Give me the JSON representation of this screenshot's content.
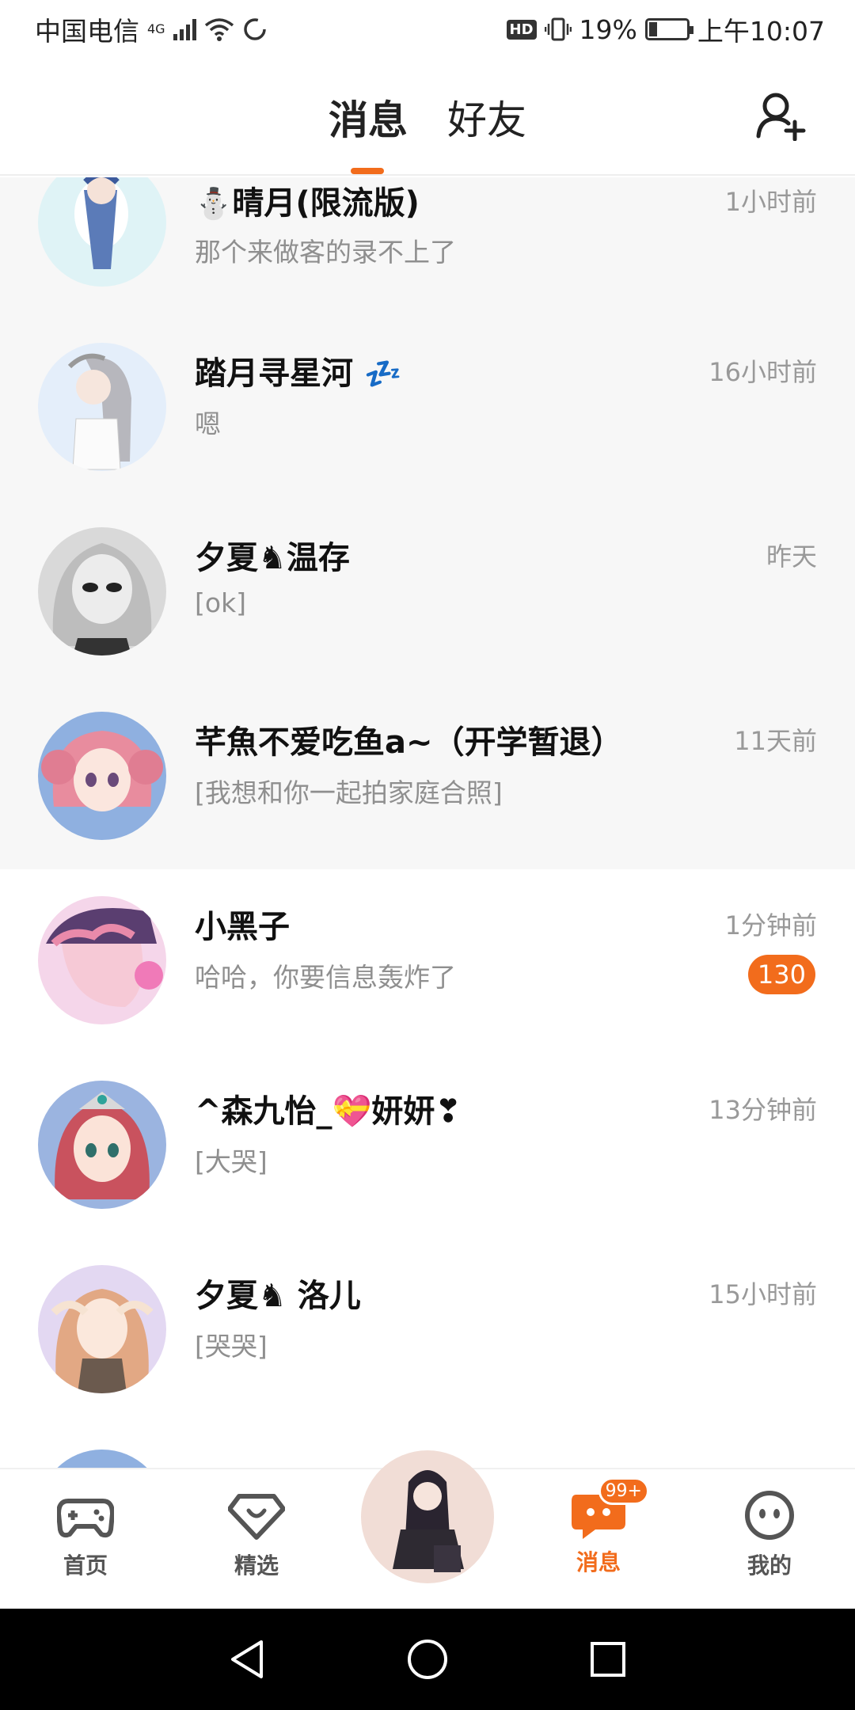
{
  "status_bar": {
    "carrier": "中国电信",
    "network": "4G",
    "battery_percent": "19%",
    "time": "上午10:07",
    "hd": "HD"
  },
  "header": {
    "tabs": [
      {
        "label": "消息",
        "active": true
      },
      {
        "label": "好友",
        "active": false
      }
    ],
    "add_friend_icon": "add-person-icon"
  },
  "conversations": [
    {
      "name": "晴月(限流版)",
      "prefix_emoji": "⛄",
      "suffix_emoji": "",
      "preview": "那个来做客的录不上了",
      "time": "1小时前",
      "pinned": true,
      "badge": ""
    },
    {
      "name": "踏月寻星河",
      "prefix_emoji": "",
      "suffix_emoji": "💤",
      "preview": "嗯",
      "time": "16小时前",
      "pinned": true,
      "badge": ""
    },
    {
      "name": "夕夏♞温存",
      "prefix_emoji": "",
      "suffix_emoji": "",
      "preview": "[ok]",
      "time": "昨天",
      "pinned": true,
      "badge": ""
    },
    {
      "name": "芊魚不爱吃鱼a~（开学暂退）",
      "prefix_emoji": "",
      "suffix_emoji": "",
      "preview": "[我想和你一起拍家庭合照]",
      "time": "11天前",
      "pinned": true,
      "badge": ""
    },
    {
      "name": "小黑子",
      "prefix_emoji": "",
      "suffix_emoji": "",
      "preview": "哈哈，你要信息轰炸了",
      "time": "1分钟前",
      "pinned": false,
      "badge": "130"
    },
    {
      "name": "^森九怡_💝妍妍❣",
      "prefix_emoji": "",
      "suffix_emoji": "",
      "preview": "[大哭]",
      "time": "13分钟前",
      "pinned": false,
      "badge": ""
    },
    {
      "name": "夕夏♞ 洛儿",
      "prefix_emoji": "",
      "suffix_emoji": "",
      "preview": "[哭哭]",
      "time": "15小时前",
      "pinned": false,
      "badge": ""
    }
  ],
  "bottom_nav": {
    "items": [
      {
        "label": "首页",
        "icon": "gamepad-icon",
        "active": false
      },
      {
        "label": "精选",
        "icon": "heart-diamond-icon",
        "active": false
      },
      {
        "label": "消息",
        "icon": "chat-bubble-icon",
        "active": true,
        "badge": "99+"
      },
      {
        "label": "我的",
        "icon": "face-icon",
        "active": false
      }
    ]
  },
  "colors": {
    "accent": "#f26c1c",
    "pinned_bg": "#f7f7f7"
  }
}
